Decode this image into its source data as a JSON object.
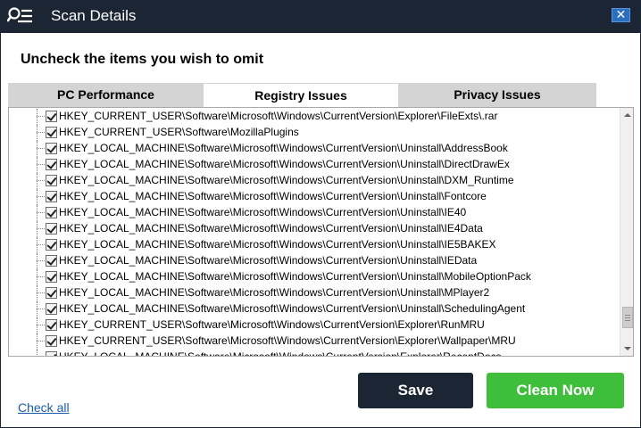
{
  "window": {
    "title": "Scan Details",
    "close_glyph": "✕",
    "app_icon": "search-list-icon"
  },
  "instructions": "Uncheck the items you wish to omit",
  "tabs": [
    {
      "label": "PC Performance",
      "active": false
    },
    {
      "label": "Registry Issues",
      "active": true
    },
    {
      "label": "Privacy Issues",
      "active": false
    }
  ],
  "items": [
    {
      "label": "HKEY_CURRENT_USER\\Software\\Microsoft\\Windows\\CurrentVersion\\Explorer\\FileExts\\.rar",
      "checked": true
    },
    {
      "label": "HKEY_CURRENT_USER\\Software\\MozillaPlugins",
      "checked": true
    },
    {
      "label": "HKEY_LOCAL_MACHINE\\Software\\Microsoft\\Windows\\CurrentVersion\\Uninstall\\AddressBook",
      "checked": true
    },
    {
      "label": "HKEY_LOCAL_MACHINE\\Software\\Microsoft\\Windows\\CurrentVersion\\Uninstall\\DirectDrawEx",
      "checked": true
    },
    {
      "label": "HKEY_LOCAL_MACHINE\\Software\\Microsoft\\Windows\\CurrentVersion\\Uninstall\\DXM_Runtime",
      "checked": true
    },
    {
      "label": "HKEY_LOCAL_MACHINE\\Software\\Microsoft\\Windows\\CurrentVersion\\Uninstall\\Fontcore",
      "checked": true
    },
    {
      "label": "HKEY_LOCAL_MACHINE\\Software\\Microsoft\\Windows\\CurrentVersion\\Uninstall\\IE40",
      "checked": true
    },
    {
      "label": "HKEY_LOCAL_MACHINE\\Software\\Microsoft\\Windows\\CurrentVersion\\Uninstall\\IE4Data",
      "checked": true
    },
    {
      "label": "HKEY_LOCAL_MACHINE\\Software\\Microsoft\\Windows\\CurrentVersion\\Uninstall\\IE5BAKEX",
      "checked": true
    },
    {
      "label": "HKEY_LOCAL_MACHINE\\Software\\Microsoft\\Windows\\CurrentVersion\\Uninstall\\IEData",
      "checked": true
    },
    {
      "label": "HKEY_LOCAL_MACHINE\\Software\\Microsoft\\Windows\\CurrentVersion\\Uninstall\\MobileOptionPack",
      "checked": true
    },
    {
      "label": "HKEY_LOCAL_MACHINE\\Software\\Microsoft\\Windows\\CurrentVersion\\Uninstall\\MPlayer2",
      "checked": true
    },
    {
      "label": "HKEY_LOCAL_MACHINE\\Software\\Microsoft\\Windows\\CurrentVersion\\Uninstall\\SchedulingAgent",
      "checked": true
    },
    {
      "label": "HKEY_CURRENT_USER\\Software\\Microsoft\\Windows\\CurrentVersion\\Explorer\\RunMRU",
      "checked": true
    },
    {
      "label": "HKEY_CURRENT_USER\\Software\\Microsoft\\Windows\\CurrentVersion\\Explorer\\Wallpaper\\MRU",
      "checked": true
    },
    {
      "label": "HKEY_LOCAL_MACHINE\\Software\\Microsoft\\Windows\\CurrentVersion\\Explorer\\RecentDocs",
      "checked": true
    }
  ],
  "footer": {
    "check_all": "Check all",
    "save": "Save",
    "clean_now": "Clean Now"
  },
  "colors": {
    "titlebar": "#1c2533",
    "close_button": "#2a6fc1",
    "save_button": "#1c2533",
    "clean_button": "#3fbe3b",
    "link": "#1a5ca8"
  }
}
